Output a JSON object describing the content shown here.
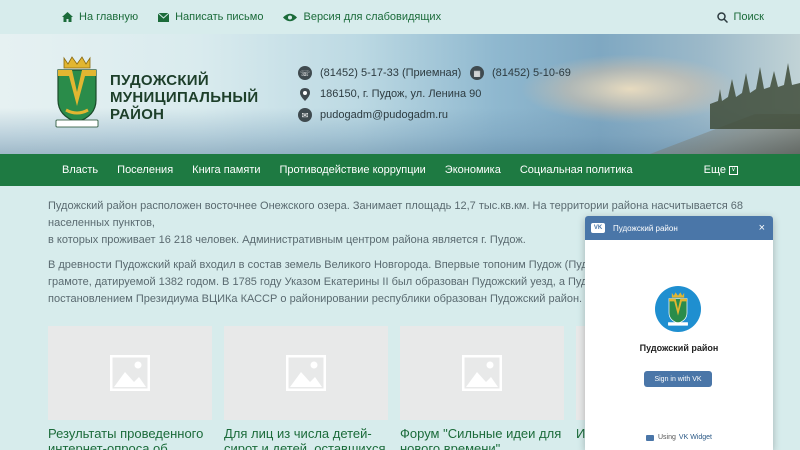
{
  "topbar": {
    "home": "На главную",
    "write": "Написать письмо",
    "accessibility": "Версия для слабовидящих",
    "search": "Поиск"
  },
  "header": {
    "name_line1": "ПУДОЖСКИЙ",
    "name_line2": "МУНИЦИПАЛЬНЫЙ",
    "name_line3": "РАЙОН",
    "phone_reception": "(81452) 5-17-33 (Приемная)",
    "fax": "(81452) 5-10-69",
    "address": "186150, г. Пудож, ул. Ленина 90",
    "email": "pudogadm@pudogadm.ru"
  },
  "nav": {
    "items": [
      "Власть",
      "Поселения",
      "Книга памяти",
      "Противодействие коррупции",
      "Экономика",
      "Социальная политика"
    ],
    "more": "Еще"
  },
  "content": {
    "p1_line1": "Пудожский район расположен восточнее Онежского озера. Занимает площадь 12,7 тыс.кв.км. На территории района насчитывается 68 населенных пунктов,",
    "p1_line2": "в которых проживает 16 218 человек. Административным центром района является  г. Пудож.",
    "p2_line1": "В древности Пудожский край входил в состав земель Великого Новгорода. Впервые топоним Пудож (Пудога) упоминается в",
    "p2_line2": "грамоте, датируемой 1382 годом. В 1785 году Указом Екатерины II был образован Пудожский уезд, а Пудожский погост пол",
    "p2_line3": "постановлением Президиума ВЦИКа КАССР о районировании республики образован Пудожский район."
  },
  "cards": [
    {
      "title_l1": "Результаты проведенного",
      "title_l2": "интернет-опроса об оценке"
    },
    {
      "title_l1": "Для лиц из числа детей-",
      "title_l2": "сирот и детей, оставшихся"
    },
    {
      "title_l1": "Форум \"Сильные идеи для",
      "title_l2": "нового времени\""
    },
    {
      "title_l1": "И",
      "title_l2": ""
    }
  ],
  "vk": {
    "header_title": "Пудожский район",
    "close": "×",
    "group_name": "Пудожский район",
    "signin": "Sign in with VK",
    "using": "Using",
    "widget_link": "VK Widget",
    "logo": "VK"
  },
  "colors": {
    "green": "#1e7a42",
    "link_green": "#1b6b3a",
    "vk_blue": "#4a76a8"
  }
}
